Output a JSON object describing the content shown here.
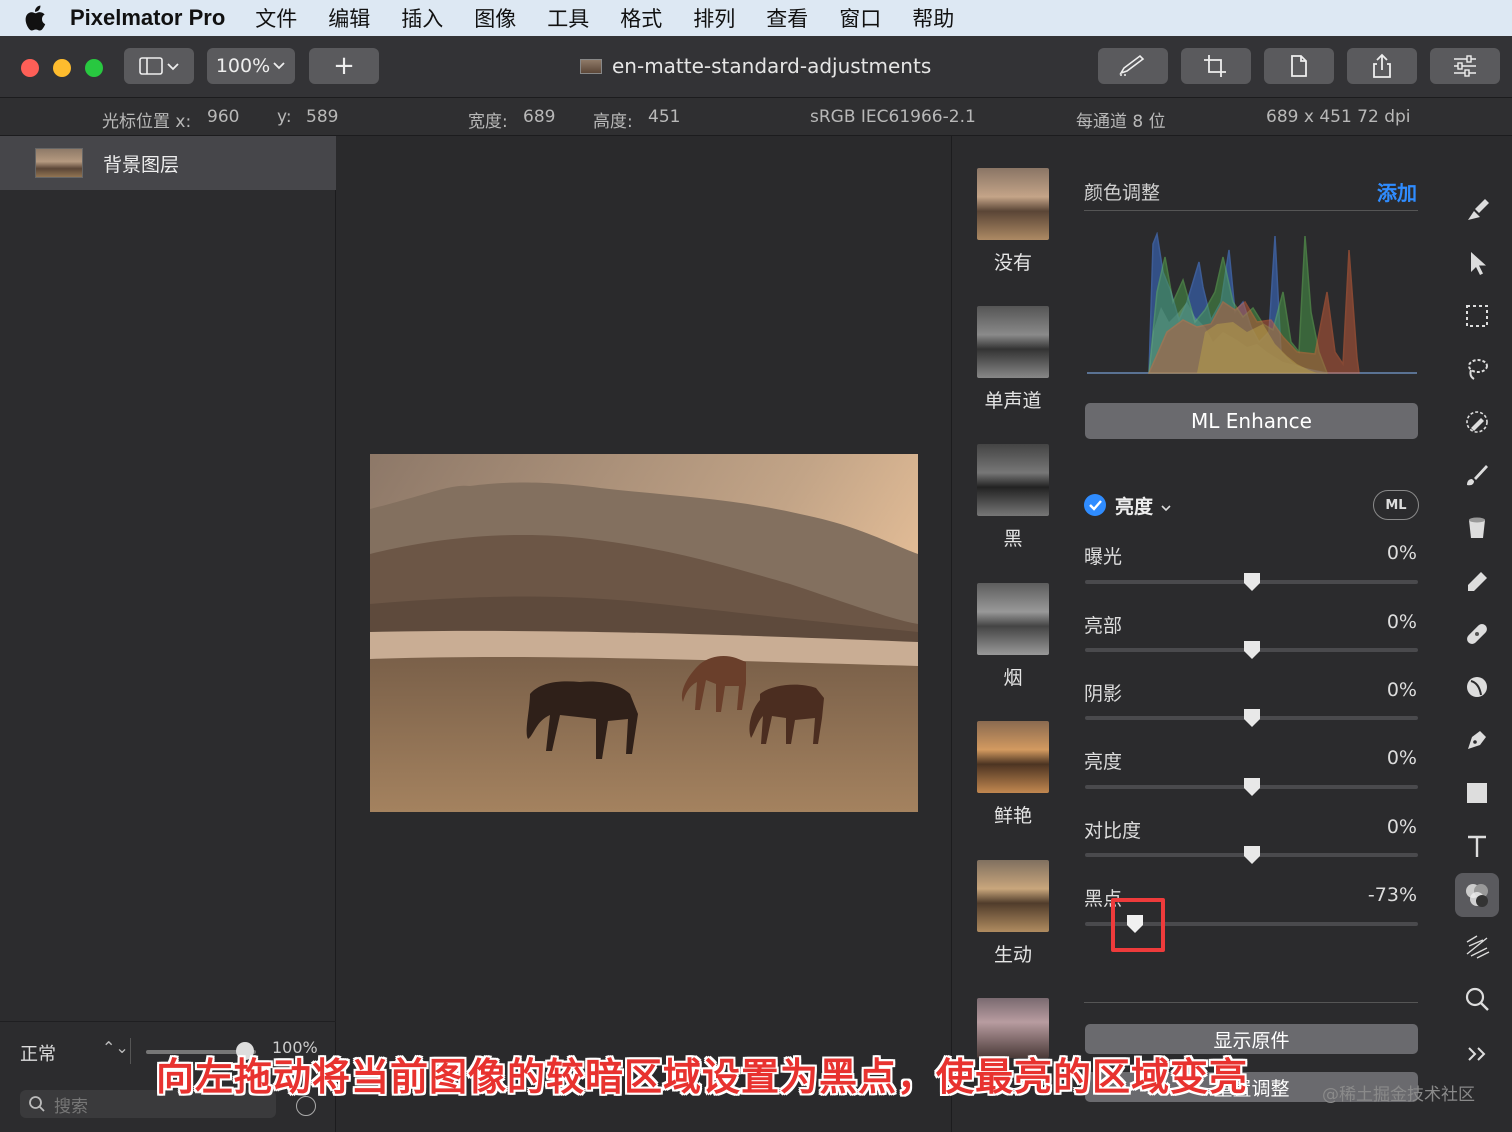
{
  "menubar": {
    "app_name": "Pixelmator Pro",
    "items": [
      "文件",
      "编辑",
      "插入",
      "图像",
      "工具",
      "格式",
      "排列",
      "查看",
      "窗口",
      "帮助"
    ]
  },
  "toolbar": {
    "zoom": "100%",
    "add": "+",
    "document_title": "en-matte-standard-adjustments"
  },
  "infobar": {
    "cursor_x_label": "光标位置 x:",
    "cursor_x": "960",
    "cursor_y_label": "y:",
    "cursor_y": "589",
    "width_label": "宽度:",
    "width": "689",
    "height_label": "高度:",
    "height": "451",
    "color_profile": "sRGB IEC61966-2.1",
    "bit_depth": "每通道 8 位",
    "size_dpi": "689 x 451 72 dpi"
  },
  "layers": {
    "layer_name": "背景图层",
    "blend_mode": "正常",
    "opacity": "100%",
    "search_placeholder": "搜索"
  },
  "presets": [
    "没有",
    "单声道",
    "黑",
    "烟",
    "鲜艳",
    "生动"
  ],
  "adjustments": {
    "title": "颜色调整",
    "add_label": "添加",
    "ml_enhance": "ML Enhance",
    "section": "亮度",
    "ml_badge": "ML",
    "sliders": [
      {
        "label": "曝光",
        "value": "0%",
        "level": 0.5
      },
      {
        "label": "亮部",
        "value": "0%",
        "level": 0.5
      },
      {
        "label": "阴影",
        "value": "0%",
        "level": 0.5
      },
      {
        "label": "亮度",
        "value": "0%",
        "level": 0.5
      },
      {
        "label": "对比度",
        "value": "0%",
        "level": 0.5
      },
      {
        "label": "黑点",
        "value": "-73%",
        "level": 0.15
      }
    ],
    "show_original": "显示原件",
    "reset": "重置调整"
  },
  "caption": "向左拖动将当前图像的较暗区域设置为黑点，使最亮的区域变亮",
  "watermark": "@稀土掘金技术社区",
  "colors": {
    "accent": "#2f8cff",
    "highlight": "#ee3b3b"
  }
}
